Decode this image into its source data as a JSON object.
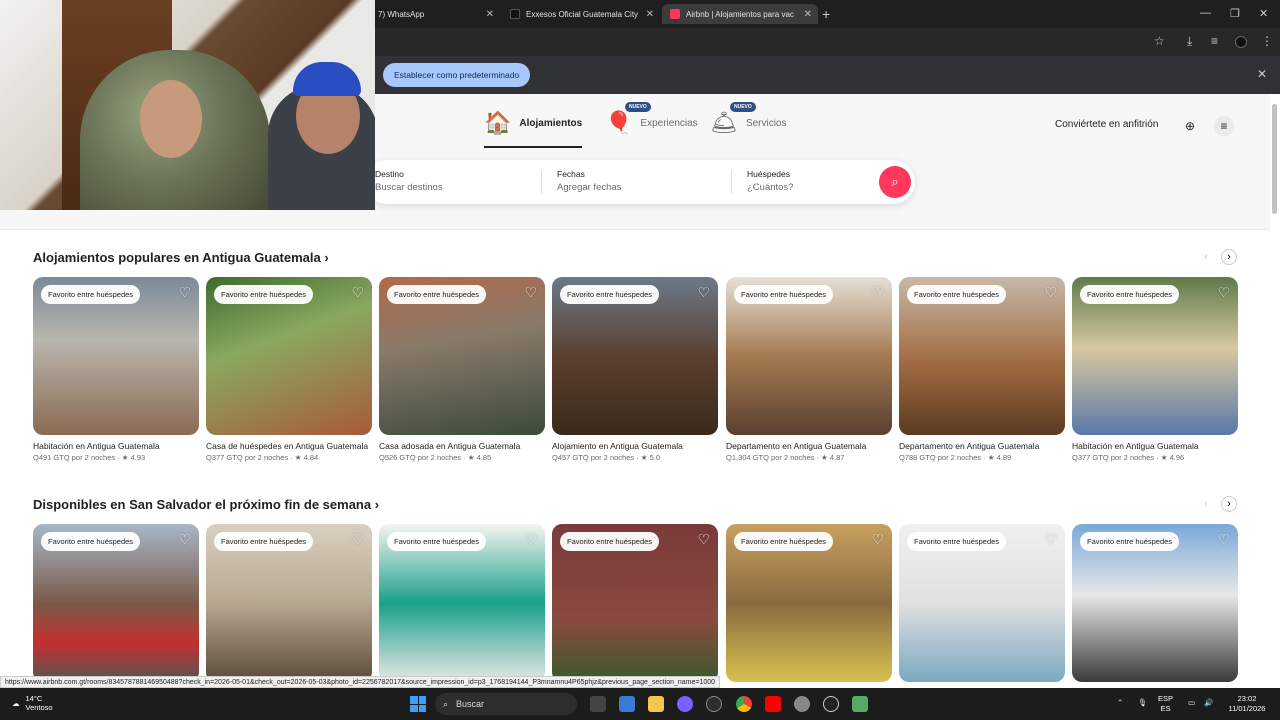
{
  "browser": {
    "tabs": [
      {
        "label": "7) WhatsApp"
      },
      {
        "label": "Exxesos Oficial Guatemala City"
      },
      {
        "label": "Airbnb | Alojamientos para vac"
      }
    ],
    "default_button": "Establecer como predeterminado"
  },
  "airbnb": {
    "nav": [
      {
        "label": "Alojamientos",
        "icon": "house-icon"
      },
      {
        "label": "Experiencias",
        "badge": "NUEVO",
        "icon": "balloon-icon"
      },
      {
        "label": "Servicios",
        "badge": "NUEVO",
        "icon": "bell-icon"
      }
    ],
    "host_link": "Conviértete en anfitrión",
    "search": {
      "dest_label": "Destino",
      "dest_value": "Buscar destinos",
      "dates_label": "Fechas",
      "dates_value": "Agregar fechas",
      "guests_label": "Huéspedes",
      "guests_value": "¿Cuántos?"
    },
    "section1_title": "Alojamientos populares en Antigua Guatemala ›",
    "section2_title": "Disponibles en San Salvador el próximo fin de semana ›",
    "fav_badge": "Favorito entre huéspedes",
    "section1_cards": [
      {
        "name": "Habitación en Antigua Guatemala",
        "price": "Q491 GTQ por 2 noches · ★ 4.93"
      },
      {
        "name": "Casa de huéspedes en Antigua Guatemala",
        "price": "Q377 GTQ por 2 noches · ★ 4.84"
      },
      {
        "name": "Casa adosada en Antigua Guatemala",
        "price": "Q526 GTQ por 2 noches · ★ 4.85"
      },
      {
        "name": "Alojamiento en Antigua Guatemala",
        "price": "Q457 GTQ por 2 noches · ★ 5.0"
      },
      {
        "name": "Departamento en Antigua Guatemala",
        "price": "Q1,304 GTQ por 2 noches · ★ 4.87"
      },
      {
        "name": "Departamento en Antigua Guatemala",
        "price": "Q788 GTQ por 2 noches · ★ 4.89"
      },
      {
        "name": "Habitación en Antigua Guatemala",
        "price": "Q377 GTQ por 2 noches · ★ 4.96"
      }
    ]
  },
  "status_url": "https://www.airbnb.com.gt/rooms/834578788146950488?check_in=2026-05-01&check_out=2026-05-03&photo_id=2256782017&source_impression_id=p3_1768194144_P3mnamnu4P65phjz&previous_page_section_name=1000",
  "taskbar": {
    "temp": "14°C",
    "weather": "Ventoso",
    "search": "Buscar",
    "lang1": "ESP",
    "lang2": "ES",
    "time": "23:02",
    "date": "11/01/2026"
  }
}
